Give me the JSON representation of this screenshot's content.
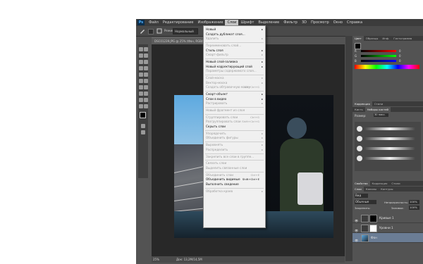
{
  "app": {
    "logo": "Ps"
  },
  "menubar": [
    "Файл",
    "Редактирование",
    "Изображение",
    "Слои",
    "Шрифт",
    "Выделение",
    "Фильтр",
    "3D",
    "Просмотр",
    "Окно",
    "Справка"
  ],
  "menubar_active": 3,
  "options": {
    "mode_label": "Режим:",
    "mode_value": "Нормальный"
  },
  "document": {
    "tab": "DSC01239.JPG @ 25% (Фон, RGB/8*)",
    "zoom": "25%",
    "doc_info": "Док: 13,2M/14,5M"
  },
  "layers_menu": [
    {
      "t": "Новый",
      "arrow": true
    },
    {
      "t": "Создать дубликат слоя..."
    },
    {
      "t": "Удалить",
      "arrow": true,
      "dim": true
    },
    {
      "sep": true
    },
    {
      "t": "Переименовать слой...",
      "dim": true
    },
    {
      "t": "Стиль слоя",
      "arrow": true
    },
    {
      "t": "Смарт-фильтр",
      "arrow": true,
      "dim": true
    },
    {
      "sep": true
    },
    {
      "t": "Новый слой-заливка",
      "arrow": true
    },
    {
      "t": "Новый корректирующий слой",
      "arrow": true
    },
    {
      "t": "Параметры содержимого слоя...",
      "dim": true
    },
    {
      "sep": true
    },
    {
      "t": "Слой-маска",
      "arrow": true,
      "dim": true
    },
    {
      "t": "Вектор-маска",
      "arrow": true,
      "dim": true
    },
    {
      "t": "Создать обтравочную маску",
      "s": "Alt+Ctrl+G",
      "dim": true
    },
    {
      "sep": true
    },
    {
      "t": "Смарт-объект",
      "arrow": true
    },
    {
      "t": "Слои в видео",
      "arrow": true
    },
    {
      "t": "Растрировать",
      "arrow": true,
      "dim": true
    },
    {
      "sep": true
    },
    {
      "t": "Новый фрагмент из слоя",
      "dim": true
    },
    {
      "sep": true
    },
    {
      "t": "Сгруппировать слои",
      "s": "Ctrl+G",
      "dim": true
    },
    {
      "t": "Разгруппировать слои",
      "s": "Shift+Ctrl+G",
      "dim": true
    },
    {
      "t": "Скрыть слои"
    },
    {
      "sep": true
    },
    {
      "t": "Упорядочить",
      "arrow": true,
      "dim": true
    },
    {
      "t": "Объединить фигуры",
      "arrow": true,
      "dim": true
    },
    {
      "sep": true
    },
    {
      "t": "Выровнять",
      "arrow": true,
      "dim": true
    },
    {
      "t": "Распределить",
      "arrow": true,
      "dim": true
    },
    {
      "sep": true
    },
    {
      "t": "Закрепить все слои в группе...",
      "dim": true
    },
    {
      "sep": true
    },
    {
      "t": "Связать слои",
      "dim": true
    },
    {
      "t": "Выделить связанные слои",
      "dim": true
    },
    {
      "sep": true
    },
    {
      "t": "Объединить слои",
      "s": "Ctrl+E",
      "dim": true
    },
    {
      "t": "Объединить видимые",
      "s": "Shift+Ctrl+E"
    },
    {
      "t": "Выполнить сведение"
    },
    {
      "sep": true
    },
    {
      "t": "Обработка краев",
      "arrow": true,
      "dim": true
    }
  ],
  "panels": {
    "color_tabs": [
      "Цвет",
      "Образцы",
      "Инф.",
      "Гистограмма"
    ],
    "color_channels": [
      {
        "label": "R",
        "value": "0"
      },
      {
        "label": "G",
        "value": "0"
      },
      {
        "label": "B",
        "value": "0"
      }
    ],
    "brush_tabs": [
      "Кисть",
      "Наборы кистей"
    ],
    "brush_size_label": "Размер:",
    "brush_size": "30 пикс.",
    "adjust_tabs": [
      "Коррекция",
      "Стили"
    ],
    "layers_tabs": [
      "Слои",
      "Каналы",
      "Контуры"
    ],
    "mini_tabs": [
      "Свойства",
      "Коррекция",
      "Стили"
    ],
    "kind_label": "Вид",
    "blend_mode": "Обычные",
    "opacity_label": "Непрозрачность:",
    "opacity": "100%",
    "lock_label": "Закрепить:",
    "fill_label": "Заливка:",
    "fill": "100%",
    "layers": [
      {
        "name": "Кривые 1"
      },
      {
        "name": "Уровни 1"
      },
      {
        "name": "Фон"
      }
    ]
  },
  "colors": {
    "menu_bg": "#f0f0f0",
    "ui_dark": "#3c3c3c",
    "selected_layer": "#6b7d95"
  }
}
